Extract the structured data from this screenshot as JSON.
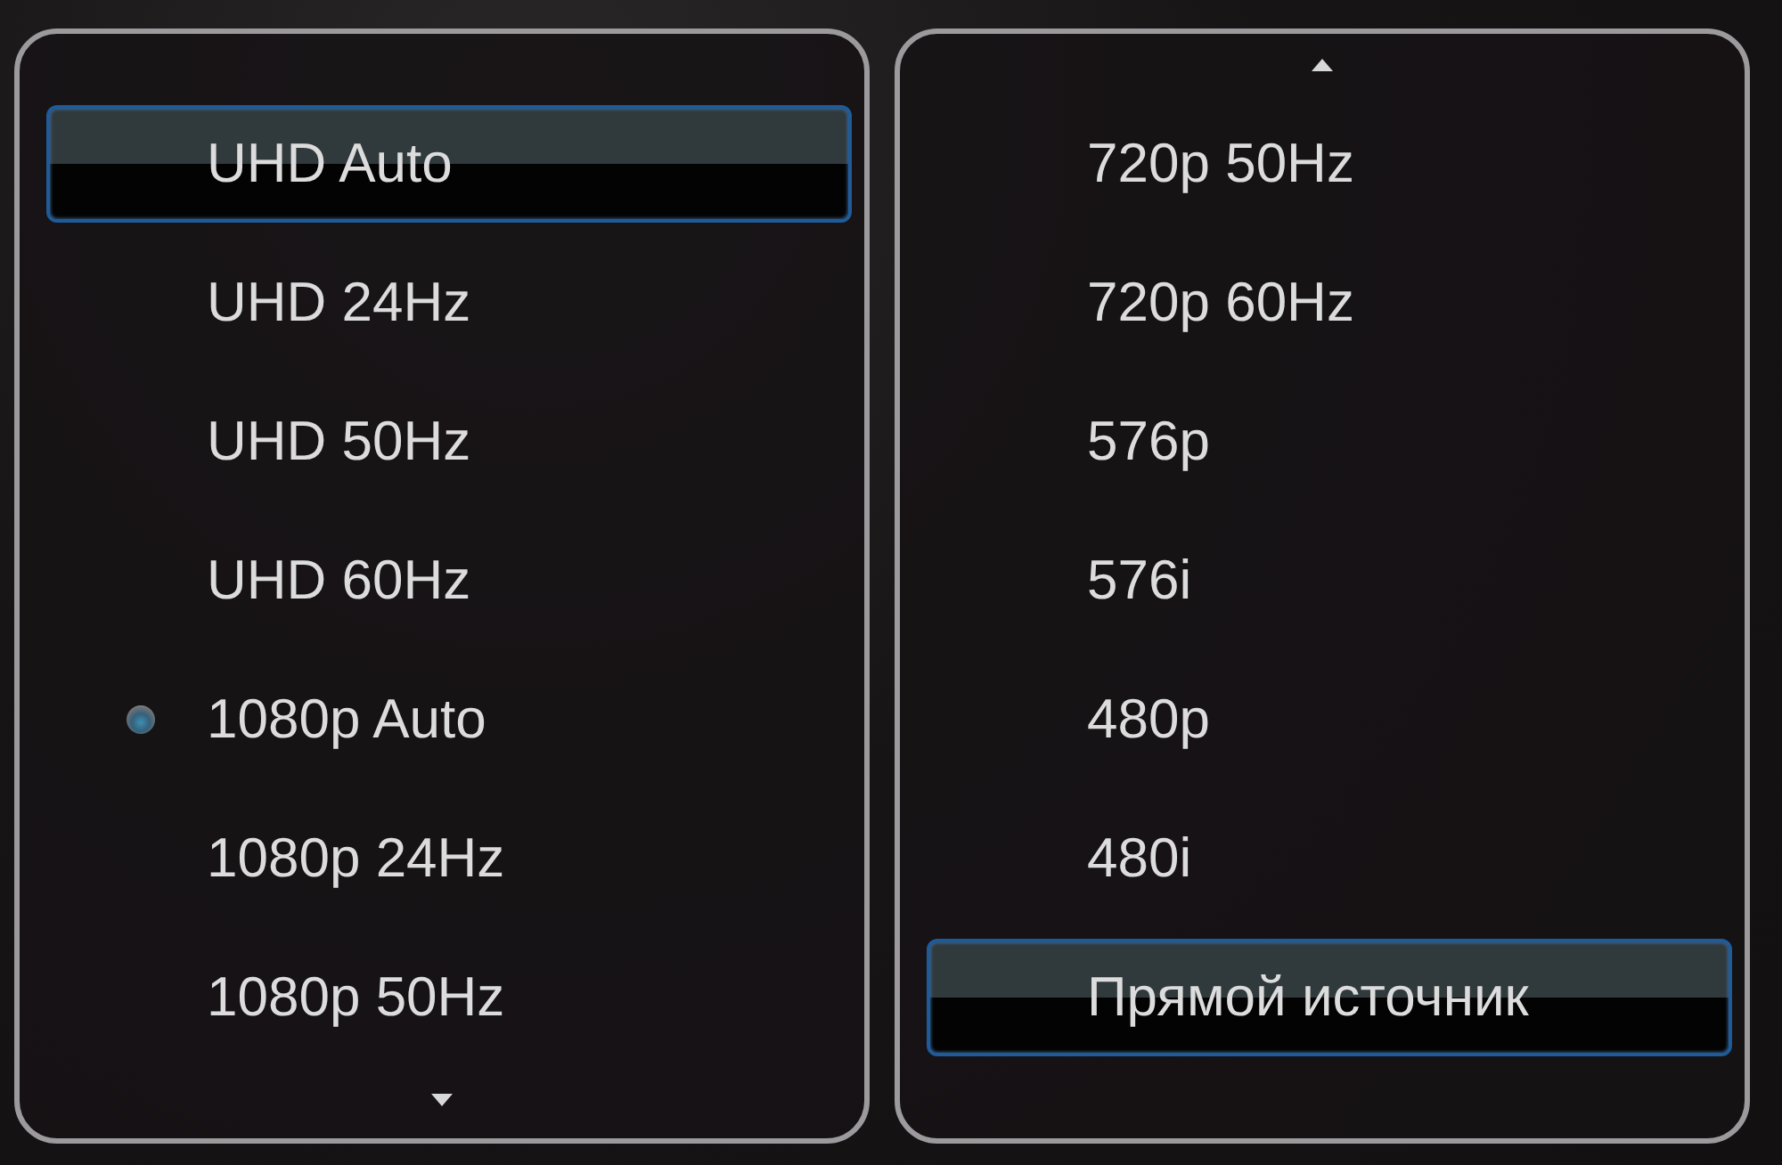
{
  "panels": [
    {
      "scroll_up": false,
      "scroll_down": true,
      "items": [
        {
          "label": "UHD Auto",
          "selected": true,
          "checked": false
        },
        {
          "label": "UHD 24Hz",
          "selected": false,
          "checked": false
        },
        {
          "label": "UHD 50Hz",
          "selected": false,
          "checked": false
        },
        {
          "label": "UHD 60Hz",
          "selected": false,
          "checked": false
        },
        {
          "label": "1080p Auto",
          "selected": false,
          "checked": true
        },
        {
          "label": "1080p 24Hz",
          "selected": false,
          "checked": false
        },
        {
          "label": "1080p 50Hz",
          "selected": false,
          "checked": false
        }
      ]
    },
    {
      "scroll_up": true,
      "scroll_down": false,
      "items": [
        {
          "label": "720p 50Hz",
          "selected": false,
          "checked": false
        },
        {
          "label": "720p 60Hz",
          "selected": false,
          "checked": false
        },
        {
          "label": "576p",
          "selected": false,
          "checked": false
        },
        {
          "label": "576i",
          "selected": false,
          "checked": false
        },
        {
          "label": "480p",
          "selected": false,
          "checked": false
        },
        {
          "label": "480i",
          "selected": false,
          "checked": false
        },
        {
          "label": "Прямой источник",
          "selected": true,
          "checked": false
        }
      ]
    }
  ]
}
